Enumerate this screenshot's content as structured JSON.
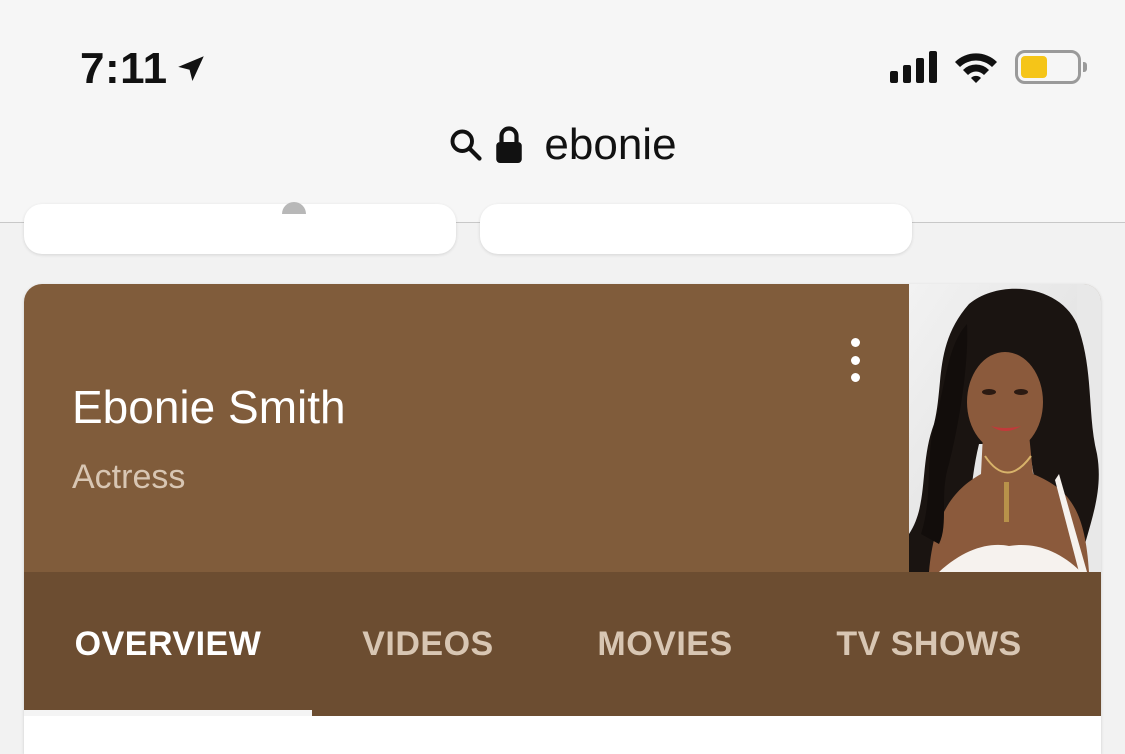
{
  "status_bar": {
    "time": "7:11"
  },
  "url_bar": {
    "query": "ebonie"
  },
  "knowledge_panel": {
    "name": "Ebonie Smith",
    "subtitle": "Actress",
    "colors": {
      "header": "#805c3b",
      "tabs": "#6c4d31",
      "tab_inactive_text": "#d8c6b3",
      "tab_active_text": "#ffffff"
    },
    "tabs": [
      {
        "label": "OVERVIEW",
        "active": true
      },
      {
        "label": "VIDEOS",
        "active": false
      },
      {
        "label": "MOVIES",
        "active": false
      },
      {
        "label": "TV SHOWS",
        "active": false
      }
    ]
  },
  "icons": [
    "location-arrow-icon",
    "signal-icon",
    "wifi-icon",
    "battery-icon",
    "search-icon",
    "lock-icon",
    "more-vert-icon"
  ]
}
